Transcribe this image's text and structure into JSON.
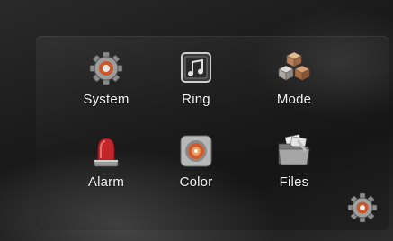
{
  "menu": {
    "items": [
      {
        "label": "System",
        "icon": "gear-icon"
      },
      {
        "label": "Ring",
        "icon": "music-note-icon"
      },
      {
        "label": "Mode",
        "icon": "cubes-icon"
      },
      {
        "label": "Alarm",
        "icon": "siren-icon"
      },
      {
        "label": "Color",
        "icon": "palette-icon"
      },
      {
        "label": "Files",
        "icon": "folder-icon"
      }
    ]
  },
  "corner_button": {
    "icon": "settings-gear-icon"
  },
  "colors": {
    "background": "#151515",
    "label": "#f2f2f2",
    "accent_red": "#c0262a"
  }
}
